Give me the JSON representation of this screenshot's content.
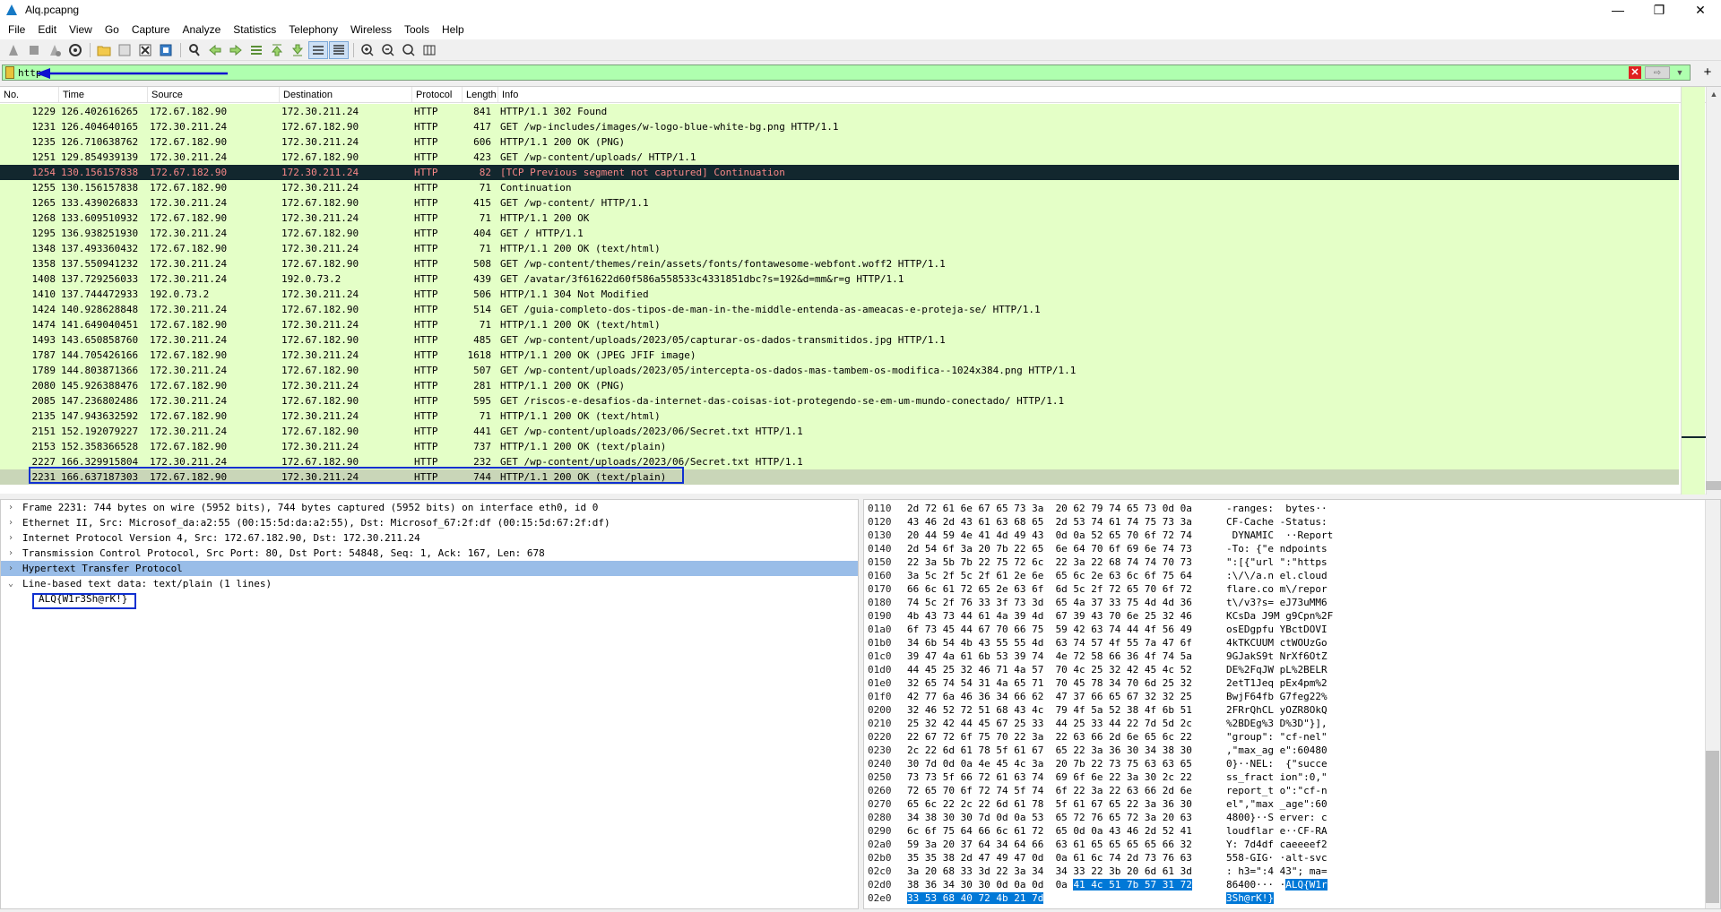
{
  "window": {
    "title": "Alq.pcapng",
    "minimize": "—",
    "maximize": "❐",
    "close": "✕"
  },
  "menu": [
    "File",
    "Edit",
    "View",
    "Go",
    "Capture",
    "Analyze",
    "Statistics",
    "Telephony",
    "Wireless",
    "Tools",
    "Help"
  ],
  "filter": {
    "value": "http",
    "annotation_color": "#1010d0"
  },
  "columns": {
    "no": "No.",
    "time": "Time",
    "source": "Source",
    "destination": "Destination",
    "protocol": "Protocol",
    "length": "Length",
    "info": "Info"
  },
  "packets": [
    {
      "no": "1229",
      "time": "126.402616265",
      "src": "172.67.182.90",
      "dst": "172.30.211.24",
      "proto": "HTTP",
      "len": "841",
      "info": "HTTP/1.1 302 Found"
    },
    {
      "no": "1231",
      "time": "126.404640165",
      "src": "172.30.211.24",
      "dst": "172.67.182.90",
      "proto": "HTTP",
      "len": "417",
      "info": "GET /wp-includes/images/w-logo-blue-white-bg.png HTTP/1.1"
    },
    {
      "no": "1235",
      "time": "126.710638762",
      "src": "172.67.182.90",
      "dst": "172.30.211.24",
      "proto": "HTTP",
      "len": "606",
      "info": "HTTP/1.1 200 OK  (PNG)"
    },
    {
      "no": "1251",
      "time": "129.854939139",
      "src": "172.30.211.24",
      "dst": "172.67.182.90",
      "proto": "HTTP",
      "len": "423",
      "info": "GET /wp-content/uploads/ HTTP/1.1"
    },
    {
      "no": "1254",
      "time": "130.156157838",
      "src": "172.67.182.90",
      "dst": "172.30.211.24",
      "proto": "HTTP",
      "len": "82",
      "info": "[TCP Previous segment not captured] Continuation",
      "style": "err"
    },
    {
      "no": "1255",
      "time": "130.156157838",
      "src": "172.67.182.90",
      "dst": "172.30.211.24",
      "proto": "HTTP",
      "len": "71",
      "info": "Continuation"
    },
    {
      "no": "1265",
      "time": "133.439026833",
      "src": "172.30.211.24",
      "dst": "172.67.182.90",
      "proto": "HTTP",
      "len": "415",
      "info": "GET /wp-content/ HTTP/1.1"
    },
    {
      "no": "1268",
      "time": "133.609510932",
      "src": "172.67.182.90",
      "dst": "172.30.211.24",
      "proto": "HTTP",
      "len": "71",
      "info": "HTTP/1.1 200 OK"
    },
    {
      "no": "1295",
      "time": "136.938251930",
      "src": "172.30.211.24",
      "dst": "172.67.182.90",
      "proto": "HTTP",
      "len": "404",
      "info": "GET / HTTP/1.1"
    },
    {
      "no": "1348",
      "time": "137.493360432",
      "src": "172.67.182.90",
      "dst": "172.30.211.24",
      "proto": "HTTP",
      "len": "71",
      "info": "HTTP/1.1 200 OK  (text/html)"
    },
    {
      "no": "1358",
      "time": "137.550941232",
      "src": "172.30.211.24",
      "dst": "172.67.182.90",
      "proto": "HTTP",
      "len": "508",
      "info": "GET /wp-content/themes/rein/assets/fonts/fontawesome-webfont.woff2 HTTP/1.1"
    },
    {
      "no": "1408",
      "time": "137.729256033",
      "src": "172.30.211.24",
      "dst": "192.0.73.2",
      "proto": "HTTP",
      "len": "439",
      "info": "GET /avatar/3f61622d60f586a558533c4331851dbc?s=192&d=mm&r=g HTTP/1.1"
    },
    {
      "no": "1410",
      "time": "137.744472933",
      "src": "192.0.73.2",
      "dst": "172.30.211.24",
      "proto": "HTTP",
      "len": "506",
      "info": "HTTP/1.1 304 Not Modified"
    },
    {
      "no": "1424",
      "time": "140.928628848",
      "src": "172.30.211.24",
      "dst": "172.67.182.90",
      "proto": "HTTP",
      "len": "514",
      "info": "GET /guia-completo-dos-tipos-de-man-in-the-middle-entenda-as-ameacas-e-proteja-se/ HTTP/1.1"
    },
    {
      "no": "1474",
      "time": "141.649040451",
      "src": "172.67.182.90",
      "dst": "172.30.211.24",
      "proto": "HTTP",
      "len": "71",
      "info": "HTTP/1.1 200 OK  (text/html)"
    },
    {
      "no": "1493",
      "time": "143.650858760",
      "src": "172.30.211.24",
      "dst": "172.67.182.90",
      "proto": "HTTP",
      "len": "485",
      "info": "GET /wp-content/uploads/2023/05/capturar-os-dados-transmitidos.jpg HTTP/1.1"
    },
    {
      "no": "1787",
      "time": "144.705426166",
      "src": "172.67.182.90",
      "dst": "172.30.211.24",
      "proto": "HTTP",
      "len": "1618",
      "info": "HTTP/1.1 200 OK  (JPEG JFIF image)"
    },
    {
      "no": "1789",
      "time": "144.803871366",
      "src": "172.30.211.24",
      "dst": "172.67.182.90",
      "proto": "HTTP",
      "len": "507",
      "info": "GET /wp-content/uploads/2023/05/intercepta-os-dados-mas-tambem-os-modifica--1024x384.png HTTP/1.1"
    },
    {
      "no": "2080",
      "time": "145.926388476",
      "src": "172.67.182.90",
      "dst": "172.30.211.24",
      "proto": "HTTP",
      "len": "281",
      "info": "HTTP/1.1 200 OK  (PNG)"
    },
    {
      "no": "2085",
      "time": "147.236802486",
      "src": "172.30.211.24",
      "dst": "172.67.182.90",
      "proto": "HTTP",
      "len": "595",
      "info": "GET /riscos-e-desafios-da-internet-das-coisas-iot-protegendo-se-em-um-mundo-conectado/ HTTP/1.1"
    },
    {
      "no": "2135",
      "time": "147.943632592",
      "src": "172.67.182.90",
      "dst": "172.30.211.24",
      "proto": "HTTP",
      "len": "71",
      "info": "HTTP/1.1 200 OK  (text/html)"
    },
    {
      "no": "2151",
      "time": "152.192079227",
      "src": "172.30.211.24",
      "dst": "172.67.182.90",
      "proto": "HTTP",
      "len": "441",
      "info": "GET /wp-content/uploads/2023/06/Secret.txt HTTP/1.1"
    },
    {
      "no": "2153",
      "time": "152.358366528",
      "src": "172.67.182.90",
      "dst": "172.30.211.24",
      "proto": "HTTP",
      "len": "737",
      "info": "HTTP/1.1 200 OK  (text/plain)"
    },
    {
      "no": "2227",
      "time": "166.329915804",
      "src": "172.30.211.24",
      "dst": "172.67.182.90",
      "proto": "HTTP",
      "len": "232",
      "info": "GET /wp-content/uploads/2023/06/Secret.txt HTTP/1.1"
    },
    {
      "no": "2231",
      "time": "166.637187303",
      "src": "172.67.182.90",
      "dst": "172.30.211.24",
      "proto": "HTTP",
      "len": "744",
      "info": "HTTP/1.1 200 OK  (text/plain)",
      "style": "sel"
    }
  ],
  "details": [
    {
      "text": "Frame 2231: 744 bytes on wire (5952 bits), 744 bytes captured (5952 bits) on interface eth0, id 0",
      "chevron": "›"
    },
    {
      "text": "Ethernet II, Src: Microsof_da:a2:55 (00:15:5d:da:a2:55), Dst: Microsof_67:2f:df (00:15:5d:67:2f:df)",
      "chevron": "›"
    },
    {
      "text": "Internet Protocol Version 4, Src: 172.67.182.90, Dst: 172.30.211.24",
      "chevron": "›"
    },
    {
      "text": "Transmission Control Protocol, Src Port: 80, Dst Port: 54848, Seq: 1, Ack: 167, Len: 678",
      "chevron": "›"
    },
    {
      "text": "Hypertext Transfer Protocol",
      "chevron": "›",
      "style": "hl"
    },
    {
      "text": "Line-based text data: text/plain (1 lines)",
      "chevron": "⌄"
    },
    {
      "text": "ALQ{W1r3Sh@rK!}",
      "chevron": "",
      "style": "child"
    }
  ],
  "bytes": [
    {
      "off": "0110",
      "hex": "2d 72 61 6e 67 65 73 3a  20 62 79 74 65 73 0d 0a",
      "asc": "-ranges:  bytes··"
    },
    {
      "off": "0120",
      "hex": "43 46 2d 43 61 63 68 65  2d 53 74 61 74 75 73 3a",
      "asc": "CF-Cache -Status:"
    },
    {
      "off": "0130",
      "hex": "20 44 59 4e 41 4d 49 43  0d 0a 52 65 70 6f 72 74",
      "asc": " DYNAMIC  ··Report"
    },
    {
      "off": "0140",
      "hex": "2d 54 6f 3a 20 7b 22 65  6e 64 70 6f 69 6e 74 73",
      "asc": "-To: {\"e ndpoints"
    },
    {
      "off": "0150",
      "hex": "22 3a 5b 7b 22 75 72 6c  22 3a 22 68 74 74 70 73",
      "asc": "\":[{\"url \":\"https"
    },
    {
      "off": "0160",
      "hex": "3a 5c 2f 5c 2f 61 2e 6e  65 6c 2e 63 6c 6f 75 64",
      "asc": ":\\/\\/a.n el.cloud"
    },
    {
      "off": "0170",
      "hex": "66 6c 61 72 65 2e 63 6f  6d 5c 2f 72 65 70 6f 72",
      "asc": "flare.co m\\/repor"
    },
    {
      "off": "0180",
      "hex": "74 5c 2f 76 33 3f 73 3d  65 4a 37 33 75 4d 4d 36",
      "asc": "t\\/v3?s= eJ73uMM6"
    },
    {
      "off": "0190",
      "hex": "4b 43 73 44 61 4a 39 4d  67 39 43 70 6e 25 32 46",
      "asc": "KCsDa J9M g9Cpn%2F"
    },
    {
      "off": "01a0",
      "hex": "6f 73 45 44 67 70 66 75  59 42 63 74 44 4f 56 49",
      "asc": "osEDgpfu YBctDOVI"
    },
    {
      "off": "01b0",
      "hex": "34 6b 54 4b 43 55 55 4d  63 74 57 4f 55 7a 47 6f",
      "asc": "4kTKCUUM ctWOUzGo"
    },
    {
      "off": "01c0",
      "hex": "39 47 4a 61 6b 53 39 74  4e 72 58 66 36 4f 74 5a",
      "asc": "9GJakS9t NrXf6OtZ"
    },
    {
      "off": "01d0",
      "hex": "44 45 25 32 46 71 4a 57  70 4c 25 32 42 45 4c 52",
      "asc": "DE%2FqJW pL%2BELR"
    },
    {
      "off": "01e0",
      "hex": "32 65 74 54 31 4a 65 71  70 45 78 34 70 6d 25 32",
      "asc": "2etT1Jeq pEx4pm%2"
    },
    {
      "off": "01f0",
      "hex": "42 77 6a 46 36 34 66 62  47 37 66 65 67 32 32 25",
      "asc": "BwjF64fb G7feg22%"
    },
    {
      "off": "0200",
      "hex": "32 46 52 72 51 68 43 4c  79 4f 5a 52 38 4f 6b 51",
      "asc": "2FRrQhCL yOZR8OkQ"
    },
    {
      "off": "0210",
      "hex": "25 32 42 44 45 67 25 33  44 25 33 44 22 7d 5d 2c",
      "asc": "%2BDEg%3 D%3D\"}],"
    },
    {
      "off": "0220",
      "hex": "22 67 72 6f 75 70 22 3a  22 63 66 2d 6e 65 6c 22",
      "asc": "\"group\": \"cf-nel\""
    },
    {
      "off": "0230",
      "hex": "2c 22 6d 61 78 5f 61 67  65 22 3a 36 30 34 38 30",
      "asc": ",\"max_ag e\":60480"
    },
    {
      "off": "0240",
      "hex": "30 7d 0d 0a 4e 45 4c 3a  20 7b 22 73 75 63 63 65",
      "asc": "0}··NEL:  {\"succe"
    },
    {
      "off": "0250",
      "hex": "73 73 5f 66 72 61 63 74  69 6f 6e 22 3a 30 2c 22",
      "asc": "ss_fract ion\":0,\""
    },
    {
      "off": "0260",
      "hex": "72 65 70 6f 72 74 5f 74  6f 22 3a 22 63 66 2d 6e",
      "asc": "report_t o\":\"cf-n"
    },
    {
      "off": "0270",
      "hex": "65 6c 22 2c 22 6d 61 78  5f 61 67 65 22 3a 36 30",
      "asc": "el\",\"max _age\":60"
    },
    {
      "off": "0280",
      "hex": "34 38 30 30 7d 0d 0a 53  65 72 76 65 72 3a 20 63",
      "asc": "4800}··S erver: c"
    },
    {
      "off": "0290",
      "hex": "6c 6f 75 64 66 6c 61 72  65 0d 0a 43 46 2d 52 41",
      "asc": "loudflar e··CF-RA"
    },
    {
      "off": "02a0",
      "hex": "59 3a 20 37 64 34 64 66  63 61 65 65 65 65 66 32",
      "asc": "Y: 7d4df caeeeef2"
    },
    {
      "off": "02b0",
      "hex": "35 35 38 2d 47 49 47 0d  0a 61 6c 74 2d 73 76 63",
      "asc": "558-GIG· ·alt-svc"
    },
    {
      "off": "02c0",
      "hex": "3a 20 68 33 3d 22 3a 34  34 33 22 3b 20 6d 61 3d",
      "asc": ": h3=\":4 43\"; ma="
    },
    {
      "off": "02d0",
      "hex": "38 36 34 30 30 0d 0a 0d  0a ",
      "hex_hl": "41 4c 51 7b 57 31 72",
      "asc": "86400··· ·",
      "asc_hl": "ALQ{W1r"
    },
    {
      "off": "02e0",
      "hex": "",
      "hex_hl": "33 53 68 40 72 4b 21 7d",
      "asc": "",
      "asc_hl": "3Sh@rK!}"
    }
  ]
}
